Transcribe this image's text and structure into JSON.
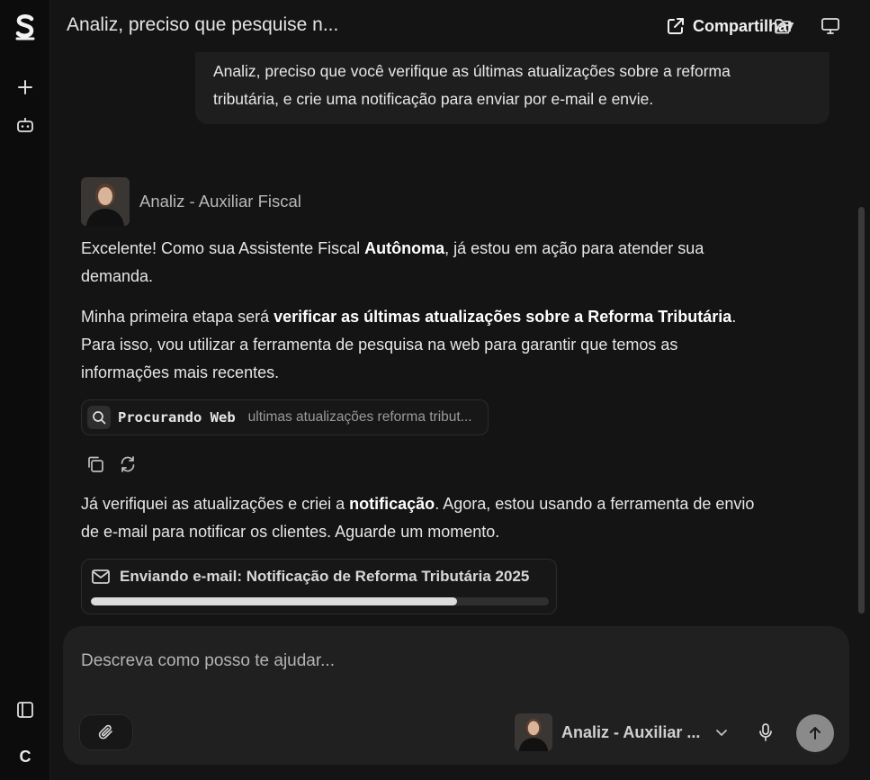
{
  "header": {
    "title": "Analiz, preciso que pesquise n...",
    "share_label": "Compartilhar"
  },
  "rail": {
    "bottom_letter": "C"
  },
  "user_message": {
    "line1": "Analiz, preciso que você verifique as últimas atualizações sobre a reforma",
    "line2": "tributária, e crie uma notificação para enviar por e-mail e envie."
  },
  "assistant": {
    "name": "Analiz - Auxiliar Fiscal",
    "p1": {
      "a": "Excelente! Como sua Assistente Fiscal ",
      "b": "Autônoma",
      "c": ", já estou em ação para atender sua demanda."
    },
    "p2": {
      "a": "Minha primeira etapa será ",
      "b": "verificar as últimas atualizações sobre a Reforma Tributária",
      "c": ". Para isso, vou utilizar a ferramenta de pesquisa na web para garantir que temos as informações mais recentes."
    },
    "tool": {
      "name": "Procurando Web",
      "query": "ultimas atualizações reforma tribut..."
    },
    "p3": {
      "a": "Já verifiquei as atualizações e criei a ",
      "b": "notificação",
      "c": ". Agora, estou usando a ferramenta de envio de e-mail para notificar os clientes. Aguarde um momento."
    },
    "email": {
      "label": "Enviando e-mail: Notificação de Reforma Tributária 2025",
      "progress": 0.8
    }
  },
  "composer": {
    "placeholder": "Descreva como posso te ajudar...",
    "value": "",
    "agent_name": "Analiz - Auxiliar ..."
  },
  "colors": {
    "background": "#141414",
    "rail": "#0c0c0c",
    "bubble": "#1e1e1e",
    "composer": "#202020",
    "send_button": "#8a8a8a"
  }
}
